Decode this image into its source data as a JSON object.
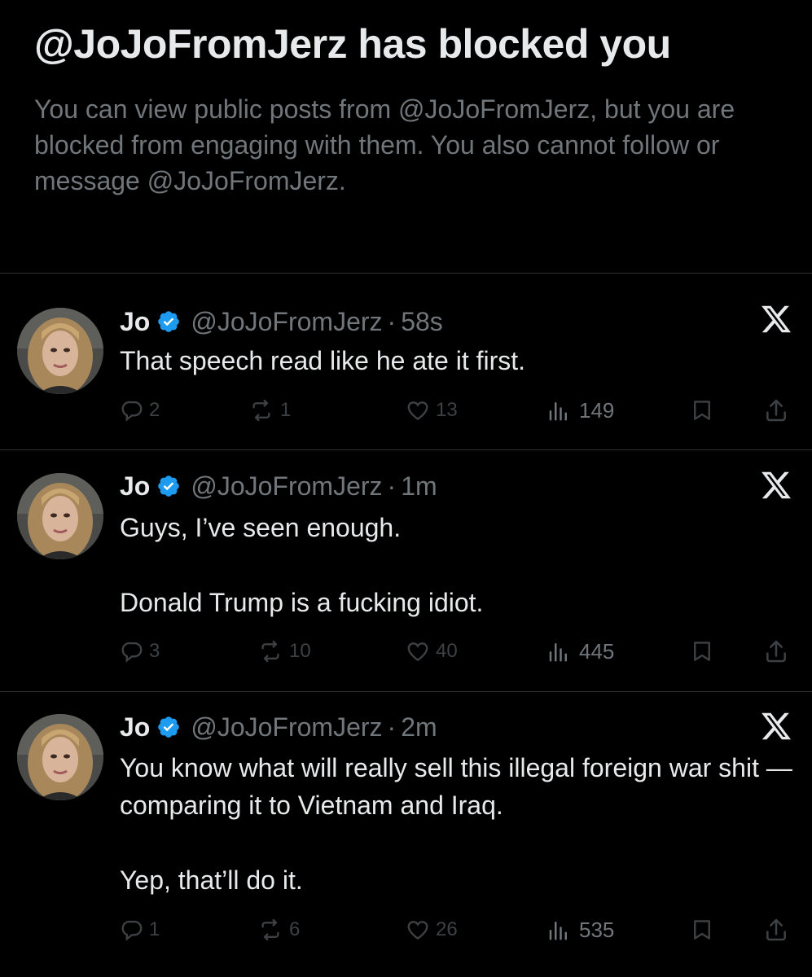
{
  "block_notice": {
    "title": "@JoJoFromJerz has blocked you",
    "description": "You can view public posts from @JoJoFromJerz, but you are blocked from engaging with them. You also cannot follow or message @JoJoFromJerz."
  },
  "colors": {
    "background": "#000000",
    "primary_text": "#e7e9ea",
    "secondary_text": "#71767b",
    "disabled_icon": "#3e4144",
    "verified_badge": "#1d9bf0",
    "divider": "#2f3336"
  },
  "posts": [
    {
      "author": "Jo",
      "handle": "@JoJoFromJerz",
      "separator": "·",
      "time": "58s",
      "paragraphs": [
        "That speech read like he ate it first."
      ],
      "replies": "2",
      "reposts": "1",
      "likes": "13",
      "views": "149"
    },
    {
      "author": "Jo",
      "handle": "@JoJoFromJerz",
      "separator": "·",
      "time": "1m",
      "paragraphs": [
        "Guys, I’ve seen enough.",
        "Donald Trump is a fucking idiot."
      ],
      "replies": "3",
      "reposts": "10",
      "likes": "40",
      "views": "445"
    },
    {
      "author": "Jo",
      "handle": "@JoJoFromJerz",
      "separator": "·",
      "time": "2m",
      "paragraphs": [
        "You know what will really sell this illegal foreign war shit — comparing it to Vietnam and Iraq.",
        "Yep, that’ll do it."
      ],
      "replies": "1",
      "reposts": "6",
      "likes": "26",
      "views": "535"
    }
  ],
  "icons": {
    "verified": "verified-badge-icon",
    "close": "x-logo-icon",
    "reply": "reply-bubble-icon",
    "repost": "repost-icon",
    "like": "heart-icon",
    "views": "bar-chart-icon",
    "bookmark": "bookmark-icon",
    "share": "share-upload-icon"
  }
}
